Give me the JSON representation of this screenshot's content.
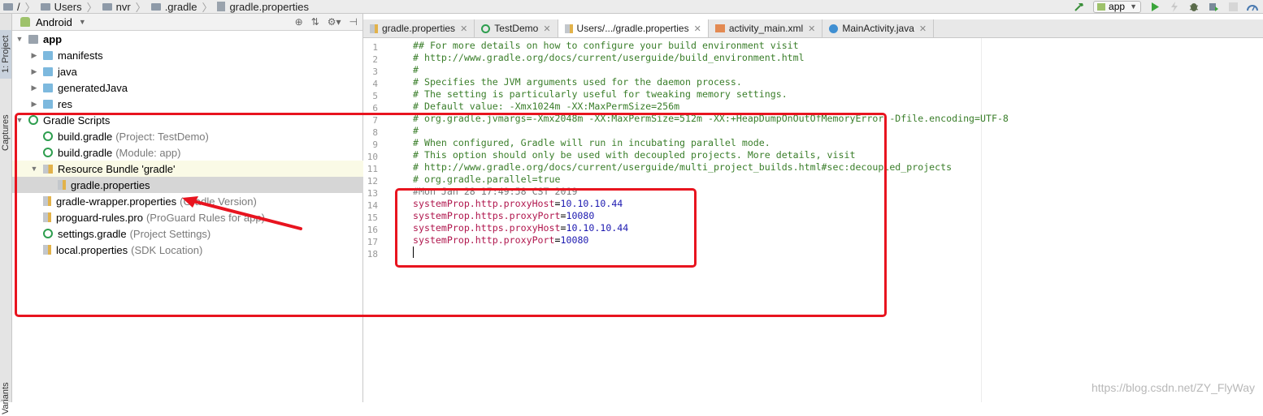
{
  "breadcrumbs": [
    {
      "label": "/",
      "icon": "folder-icon"
    },
    {
      "label": "Users",
      "icon": "folder-icon"
    },
    {
      "label": "nvr",
      "icon": "folder-icon"
    },
    {
      "label": ".gradle",
      "icon": "folder-icon"
    },
    {
      "label": "gradle.properties",
      "icon": "properties-file-icon"
    }
  ],
  "toolbar": {
    "run_config": "app",
    "icons": [
      "hammer-icon",
      "run-icon",
      "apply-changes-icon",
      "debug-icon",
      "profile-icon",
      "stop-icon",
      "profiler-icon"
    ]
  },
  "left_strip": {
    "project_tab": "1: Project",
    "captures_tab": "Captures",
    "variants_tab": "Variants"
  },
  "project_panel": {
    "view_mode": "Android",
    "tree": [
      {
        "label": "app",
        "hint": "",
        "depth": 0,
        "expander": "expanded",
        "icon": "module",
        "bold": true
      },
      {
        "label": "manifests",
        "hint": "",
        "depth": 1,
        "expander": "collapsed",
        "icon": "folder"
      },
      {
        "label": "java",
        "hint": "",
        "depth": 1,
        "expander": "collapsed",
        "icon": "folder"
      },
      {
        "label": "generatedJava",
        "hint": "",
        "depth": 1,
        "expander": "collapsed",
        "icon": "folder-gen"
      },
      {
        "label": "res",
        "hint": "",
        "depth": 1,
        "expander": "collapsed",
        "icon": "folder"
      },
      {
        "label": "Gradle Scripts",
        "hint": "",
        "depth": 0,
        "expander": "expanded",
        "icon": "gradle"
      },
      {
        "label": "build.gradle",
        "hint": "(Project: TestDemo)",
        "depth": 1,
        "expander": "none",
        "icon": "gradle"
      },
      {
        "label": "build.gradle",
        "hint": "(Module: app)",
        "depth": 1,
        "expander": "none",
        "icon": "gradle"
      },
      {
        "label": "Resource Bundle 'gradle'",
        "hint": "",
        "depth": 1,
        "expander": "expanded",
        "icon": "bundle",
        "highlight": "bundle"
      },
      {
        "label": "gradle.properties",
        "hint": "",
        "depth": 2,
        "expander": "none",
        "icon": "props",
        "highlight": "selected"
      },
      {
        "label": "gradle-wrapper.properties",
        "hint": "(Gradle Version)",
        "depth": 1,
        "expander": "none",
        "icon": "props"
      },
      {
        "label": "proguard-rules.pro",
        "hint": "(ProGuard Rules for app)",
        "depth": 1,
        "expander": "none",
        "icon": "props"
      },
      {
        "label": "settings.gradle",
        "hint": "(Project Settings)",
        "depth": 1,
        "expander": "none",
        "icon": "gradle"
      },
      {
        "label": "local.properties",
        "hint": "(SDK Location)",
        "depth": 1,
        "expander": "none",
        "icon": "props"
      }
    ]
  },
  "editor_tabs": [
    {
      "label": "gradle.properties",
      "icon": "props",
      "active": false
    },
    {
      "label": "TestDemo",
      "icon": "gradle",
      "active": false
    },
    {
      "label": "Users/.../gradle.properties",
      "icon": "props",
      "active": true
    },
    {
      "label": "activity_main.xml",
      "icon": "xml",
      "active": false
    },
    {
      "label": "MainActivity.java",
      "icon": "java",
      "active": false
    }
  ],
  "code_lines": [
    {
      "n": "1",
      "parts": [
        {
          "t": "## For more details on how to configure your build environment visit",
          "c": "comment"
        }
      ]
    },
    {
      "n": "2",
      "parts": [
        {
          "t": "# http://www.gradle.org/docs/current/userguide/build_environment.html",
          "c": "comment"
        }
      ]
    },
    {
      "n": "3",
      "parts": [
        {
          "t": "#",
          "c": "comment"
        }
      ]
    },
    {
      "n": "4",
      "parts": [
        {
          "t": "# Specifies the JVM arguments used for the daemon process.",
          "c": "comment"
        }
      ]
    },
    {
      "n": "5",
      "parts": [
        {
          "t": "# The setting is particularly useful for tweaking memory settings.",
          "c": "comment"
        }
      ]
    },
    {
      "n": "6",
      "parts": [
        {
          "t": "# Default value: -Xmx1024m -XX:MaxPermSize=256m",
          "c": "comment"
        }
      ]
    },
    {
      "n": "7",
      "parts": [
        {
          "t": "# org.gradle.jvmargs=-Xmx2048m -XX:MaxPermSize=512m -XX:+HeapDumpOnOutOfMemoryError -Dfile.encoding=UTF-8",
          "c": "comment"
        }
      ]
    },
    {
      "n": "8",
      "parts": [
        {
          "t": "#",
          "c": "comment"
        }
      ]
    },
    {
      "n": "9",
      "parts": [
        {
          "t": "# When configured, Gradle will run in incubating parallel mode.",
          "c": "comment"
        }
      ]
    },
    {
      "n": "10",
      "parts": [
        {
          "t": "# This option should only be used with decoupled projects. More details, visit",
          "c": "comment"
        }
      ]
    },
    {
      "n": "11",
      "parts": [
        {
          "t": "# http://www.gradle.org/docs/current/userguide/multi_project_builds.html#sec:decoupled_projects",
          "c": "comment"
        }
      ]
    },
    {
      "n": "12",
      "parts": [
        {
          "t": "# org.gradle.parallel=true",
          "c": "comment"
        }
      ]
    },
    {
      "n": "13",
      "parts": [
        {
          "t": "#Mon Jan 28 17:49:58 CST 2019",
          "c": "time"
        }
      ]
    },
    {
      "n": "14",
      "parts": [
        {
          "t": "systemProp.http.proxyHost",
          "c": "key"
        },
        {
          "t": "=",
          "c": "eq"
        },
        {
          "t": "10.10.10.44",
          "c": "val"
        }
      ]
    },
    {
      "n": "15",
      "parts": [
        {
          "t": "systemProp.https.proxyPort",
          "c": "key"
        },
        {
          "t": "=",
          "c": "eq"
        },
        {
          "t": "10080",
          "c": "val"
        }
      ]
    },
    {
      "n": "16",
      "parts": [
        {
          "t": "systemProp.https.proxyHost",
          "c": "key"
        },
        {
          "t": "=",
          "c": "eq"
        },
        {
          "t": "10.10.10.44",
          "c": "val"
        }
      ]
    },
    {
      "n": "17",
      "parts": [
        {
          "t": "systemProp.http.proxyPort",
          "c": "key"
        },
        {
          "t": "=",
          "c": "eq"
        },
        {
          "t": "10080",
          "c": "val"
        }
      ]
    },
    {
      "n": "18",
      "parts": []
    }
  ],
  "watermark": "https://blog.csdn.net/ZY_FlyWay",
  "colors": {
    "annotation_red": "#e8141f",
    "comment_green": "#3a7e2a",
    "key_magenta": "#b0164d",
    "value_blue": "#1c19b0",
    "selection_gray": "#d6d6d6"
  }
}
